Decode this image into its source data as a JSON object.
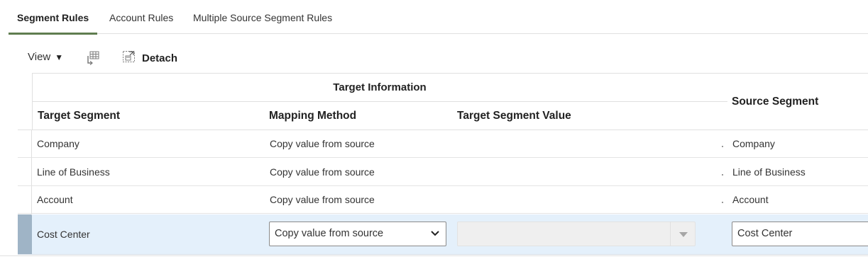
{
  "tabs": [
    {
      "label": "Segment Rules",
      "active": true
    },
    {
      "label": "Account Rules",
      "active": false
    },
    {
      "label": "Multiple Source Segment Rules",
      "active": false
    }
  ],
  "toolbar": {
    "view_label": "View",
    "view_caret": "▼",
    "freeze_icon": "freeze-columns-icon",
    "detach_icon": "detach-icon",
    "detach_label": "Detach"
  },
  "table": {
    "group_header": "Target Information",
    "columns": {
      "target_segment": "Target Segment",
      "mapping_method": "Mapping Method",
      "target_segment_value": "Target Segment Value",
      "source_segment": "Source Segment"
    },
    "rows": [
      {
        "target_segment": "Company",
        "mapping_method": "Copy value from source",
        "target_segment_value": "",
        "source_segment": "Company"
      },
      {
        "target_segment": "Line of Business",
        "mapping_method": "Copy value from source",
        "target_segment_value": "",
        "source_segment": "Line of Business"
      },
      {
        "target_segment": "Account",
        "mapping_method": "Copy value from source",
        "target_segment_value": "",
        "source_segment": "Account"
      }
    ],
    "selected_row": {
      "target_segment": "Cost Center",
      "mapping_method": "Copy value from source",
      "target_segment_value": "",
      "source_segment": "Cost Center"
    }
  },
  "colors": {
    "active_tab_underline": "#5f7d4f",
    "selected_row_bg": "#e4f0fb",
    "selected_row_marker": "#9fb4c6"
  }
}
